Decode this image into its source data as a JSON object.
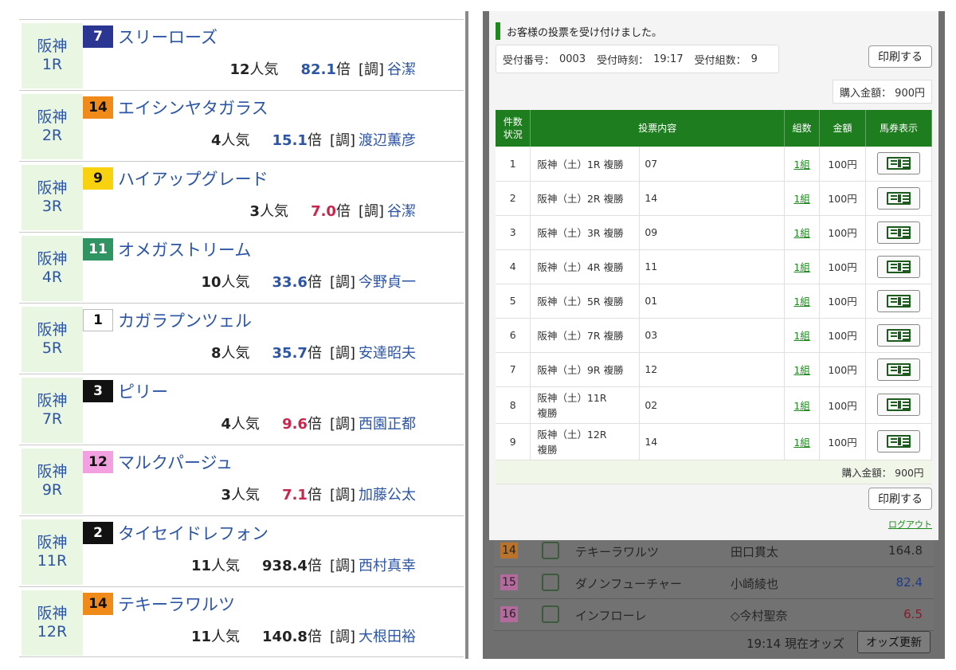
{
  "left": {
    "races": [
      {
        "track": "阪神",
        "race": "1R",
        "num": "7",
        "num_bg": "#2b3592",
        "num_color": "#ffffff",
        "horse": "スリーローズ",
        "pop_num": "12",
        "pop_suffix": "人気",
        "odds": "82.1",
        "odds_suffix": "倍",
        "odds_color": "#2d55a5",
        "jockey_tag": "[調]",
        "jockey": "谷潔"
      },
      {
        "track": "阪神",
        "race": "2R",
        "num": "14",
        "num_bg": "#f08b1a",
        "num_color": "#111111",
        "horse": "エイシンヤタガラス",
        "pop_num": "4",
        "pop_suffix": "人気",
        "odds": "15.1",
        "odds_suffix": "倍",
        "odds_color": "#2d55a5",
        "jockey_tag": "[調]",
        "jockey": "渡辺薫彦"
      },
      {
        "track": "阪神",
        "race": "3R",
        "num": "9",
        "num_bg": "#f8d20e",
        "num_color": "#111111",
        "horse": "ハイアップグレード",
        "pop_num": "3",
        "pop_suffix": "人気",
        "odds": "7.0",
        "odds_suffix": "倍",
        "odds_color": "#c8264d",
        "jockey_tag": "[調]",
        "jockey": "谷潔"
      },
      {
        "track": "阪神",
        "race": "4R",
        "num": "11",
        "num_bg": "#2f9462",
        "num_color": "#ffffff",
        "horse": "オメガストリーム",
        "pop_num": "10",
        "pop_suffix": "人気",
        "odds": "33.6",
        "odds_suffix": "倍",
        "odds_color": "#2d55a5",
        "jockey_tag": "[調]",
        "jockey": "今野貞一"
      },
      {
        "track": "阪神",
        "race": "5R",
        "num": "1",
        "num_bg": "#ffffff",
        "num_color": "#111111",
        "horse": "カガラプンツェル",
        "pop_num": "8",
        "pop_suffix": "人気",
        "odds": "35.7",
        "odds_suffix": "倍",
        "odds_color": "#2d55a5",
        "jockey_tag": "[調]",
        "jockey": "安達昭夫"
      },
      {
        "track": "阪神",
        "race": "7R",
        "num": "3",
        "num_bg": "#111111",
        "num_color": "#ffffff",
        "horse": "ピリー",
        "pop_num": "4",
        "pop_suffix": "人気",
        "odds": "9.6",
        "odds_suffix": "倍",
        "odds_color": "#c8264d",
        "jockey_tag": "[調]",
        "jockey": "西園正都"
      },
      {
        "track": "阪神",
        "race": "9R",
        "num": "12",
        "num_bg": "#f3a0e0",
        "num_color": "#111111",
        "horse": "マルクパージュ",
        "pop_num": "3",
        "pop_suffix": "人気",
        "odds": "7.1",
        "odds_suffix": "倍",
        "odds_color": "#c8264d",
        "jockey_tag": "[調]",
        "jockey": "加藤公太"
      },
      {
        "track": "阪神",
        "race": "11R",
        "num": "2",
        "num_bg": "#111111",
        "num_color": "#ffffff",
        "horse": "タイセイドレフォン",
        "pop_num": "11",
        "pop_suffix": "人気",
        "odds": "938.4",
        "odds_suffix": "倍",
        "odds_color": "#222222",
        "jockey_tag": "[調]",
        "jockey": "西村真幸"
      },
      {
        "track": "阪神",
        "race": "12R",
        "num": "14",
        "num_bg": "#f08b1a",
        "num_color": "#111111",
        "horse": "テキーラワルツ",
        "pop_num": "11",
        "pop_suffix": "人気",
        "odds": "140.8",
        "odds_suffix": "倍",
        "odds_color": "#222222",
        "jockey_tag": "[調]",
        "jockey": "大根田裕"
      }
    ]
  },
  "right": {
    "notice": "お客様の投票を受け付けました。",
    "receipt": {
      "no_label": "受付番号：",
      "no": "0003",
      "time_label": "受付時刻：",
      "time": "19:17",
      "sets_label": "受付組数：",
      "sets": "9"
    },
    "print_label": "印刷する",
    "amount_label": "購入金額：",
    "amount": "900円",
    "table": {
      "headers": {
        "idx_line1": "件数",
        "idx_line2": "状況",
        "content": "投票内容",
        "count": "組数",
        "amount": "金額",
        "ticket": "馬券表示"
      },
      "rows": [
        {
          "idx": "1",
          "race_line1": "阪神（土）1R 複勝",
          "race_line2": "",
          "content": "07",
          "count": "1組",
          "amount": "100円"
        },
        {
          "idx": "2",
          "race_line1": "阪神（土）2R 複勝",
          "race_line2": "",
          "content": "14",
          "count": "1組",
          "amount": "100円"
        },
        {
          "idx": "3",
          "race_line1": "阪神（土）3R 複勝",
          "race_line2": "",
          "content": "09",
          "count": "1組",
          "amount": "100円"
        },
        {
          "idx": "4",
          "race_line1": "阪神（土）4R 複勝",
          "race_line2": "",
          "content": "11",
          "count": "1組",
          "amount": "100円"
        },
        {
          "idx": "5",
          "race_line1": "阪神（土）5R 複勝",
          "race_line2": "",
          "content": "01",
          "count": "1組",
          "amount": "100円"
        },
        {
          "idx": "6",
          "race_line1": "阪神（土）7R 複勝",
          "race_line2": "",
          "content": "03",
          "count": "1組",
          "amount": "100円"
        },
        {
          "idx": "7",
          "race_line1": "阪神（土）9R 複勝",
          "race_line2": "",
          "content": "12",
          "count": "1組",
          "amount": "100円"
        },
        {
          "idx": "8",
          "race_line1": "阪神（土）11R",
          "race_line2": "複勝",
          "content": "02",
          "count": "1組",
          "amount": "100円"
        },
        {
          "idx": "9",
          "race_line1": "阪神（土）12R",
          "race_line2": "複勝",
          "content": "14",
          "count": "1組",
          "amount": "100円"
        }
      ],
      "total_label": "購入金額：",
      "total": "900円"
    },
    "logout": "ログアウト",
    "background": {
      "rows": [
        {
          "num": "14",
          "num_bg": "#b9732a",
          "horse": "テキーラワルツ",
          "jockey": "田口貫太",
          "odds": "164.8",
          "odds_color": "#262626"
        },
        {
          "num": "15",
          "num_bg": "#b36a9c",
          "horse": "ダノンフューチャー",
          "jockey": "小崎綾也",
          "odds": "82.4",
          "odds_color": "#1f3a8a"
        },
        {
          "num": "16",
          "num_bg": "#b36a9c",
          "horse": "インフローレ",
          "jockey": "◇今村聖奈",
          "odds": "6.5",
          "odds_color": "#8a1a2a"
        }
      ],
      "time_text": "19:14 現在オッズ",
      "update_label": "オッズ更新"
    }
  }
}
